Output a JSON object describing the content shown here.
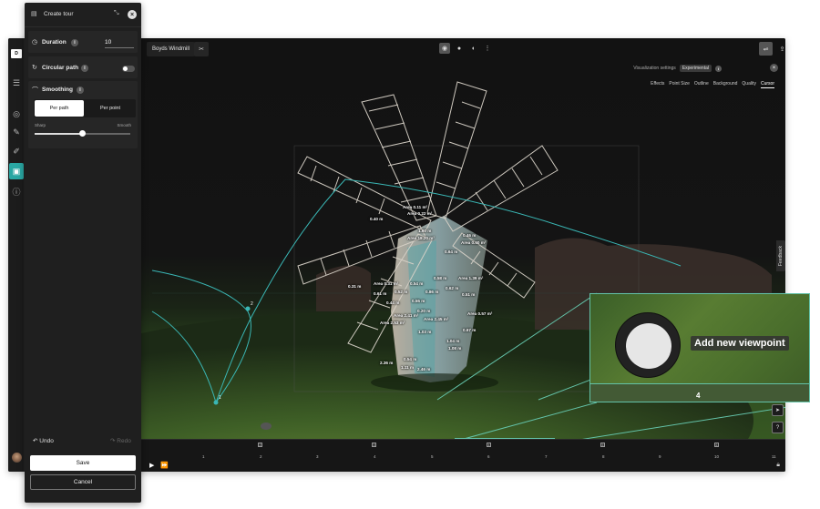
{
  "header": {
    "project_name": "Boyds Windmill"
  },
  "visualization": {
    "settings_label": "Visualization settings",
    "badge": "Experimental",
    "tabs": [
      "Effects",
      "Point Size",
      "Outline",
      "Background",
      "Quality",
      "Cursor"
    ],
    "active_tab": "Cursor"
  },
  "feedback_label": "Feedback",
  "tour_panel": {
    "title": "Create tour",
    "duration": {
      "label": "Duration",
      "value": "10"
    },
    "circular_path": {
      "label": "Circular path",
      "enabled": false
    },
    "smoothing": {
      "label": "Smoothing",
      "options": [
        "Per path",
        "Per point"
      ],
      "selected": "Per path",
      "min_label": "Sharp",
      "max_label": "Smooth",
      "level": 0.5
    },
    "undo_label": "Undo",
    "redo_label": "Redo",
    "save_label": "Save",
    "cancel_label": "Cancel"
  },
  "measurements": {
    "labels": [
      "Area 0.11 m²",
      "Area 0.22 m²",
      "1.60 m",
      "Area 18.20 m²",
      "0.40 m",
      "0.46 m",
      "Area 0.60 m²",
      "0.64 m",
      "0.58 m",
      "Area 1.39 m²",
      "Area 0.31 m²",
      "0.31 m",
      "0.61 m",
      "0.52 m",
      "0.54 m",
      "0.86 m",
      "0.55 m",
      "0.62 m",
      "0.51 m",
      "0.44 m",
      "0.20 m",
      "Area 0.57 m²",
      "Area 2.41 m²",
      "Area 2.45 m²",
      "Area 2.53 m²",
      "0.67 m",
      "1.08 m",
      "1.03 m",
      "1.04 m",
      "0.54 m",
      "2.36 m",
      "1.11 m",
      "2.46 m"
    ]
  },
  "path_points": [
    "2",
    "1"
  ],
  "viewpoint": {
    "add_label": "Add new viewpoint",
    "index": "4"
  },
  "timeline": {
    "ticks": [
      "1",
      "2",
      "3",
      "4",
      "5",
      "6",
      "7",
      "8",
      "9",
      "10",
      "11"
    ],
    "keyframes": [
      "2",
      "3",
      "4",
      "5",
      "6"
    ]
  },
  "colors": {
    "accent": "#2aa7a3",
    "callout_border": "#63c2a8",
    "panel_bg": "#1f1f1f"
  }
}
